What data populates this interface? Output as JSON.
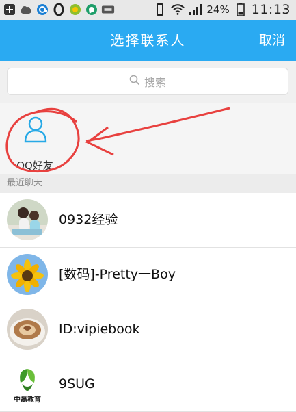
{
  "status_bar": {
    "battery_percent": "24%",
    "time": "11:13"
  },
  "header": {
    "title": "选择联系人",
    "cancel_label": "取消"
  },
  "search": {
    "placeholder": "搜索"
  },
  "qq_friends": {
    "label": "QQ好友"
  },
  "recent_chats": {
    "section_label": "最近聊天",
    "items": [
      {
        "name": "0932经验",
        "avatar": "couple-photo"
      },
      {
        "name": "[数码]-Pretty一Boy",
        "avatar": "sunflower-photo"
      },
      {
        "name": "ID:vipiebook",
        "avatar": "latte-cup-photo"
      },
      {
        "name": "9SUG",
        "avatar": "zhonglei-education-logo",
        "avatar_text": "中磊教育"
      }
    ]
  },
  "colors": {
    "accent": "#2aaaf2",
    "annotation": "#e8413f"
  }
}
